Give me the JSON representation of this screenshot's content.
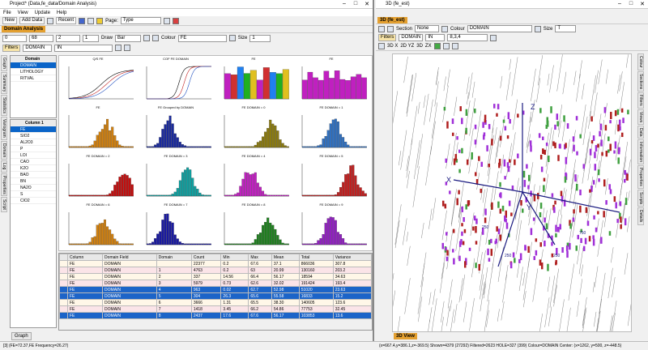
{
  "left_window": {
    "title": "Project* (Data,fe_data/Domain Analysis)",
    "menu": [
      "File",
      "View",
      "Update",
      "Help"
    ],
    "toolbar": {
      "new": "New",
      "add_data": "Add Data",
      "recent": "Recent",
      "page_label": "Page:",
      "page_value": "Type"
    },
    "panel_title": "Domain Analysis",
    "analysis_bar": {
      "v1": "0",
      "v2": "68",
      "v3": "2",
      "v4": "1",
      "draw_label": "Draw",
      "draw_value": "Bar",
      "colour_label": "Colour",
      "colour_value": "FE",
      "size_label": "Size",
      "size_value": "1"
    },
    "filter_bar": {
      "filters": "Filters",
      "field": "DOMAIN",
      "op": "IN"
    },
    "domain_list": {
      "header": "Domain",
      "items": [
        "DOMAIN",
        "LITHOLOGY",
        "RITVAL"
      ]
    },
    "column_list": {
      "header": "Column 1",
      "items": [
        "FE",
        "SIO2",
        "AL2O3",
        "P",
        "LOI",
        "CAO",
        "K2O",
        "BAO",
        "BN",
        "NA2O",
        "S",
        "CIO2"
      ]
    },
    "bottom_tab": "Graph",
    "grid": {
      "columns": [
        "Column",
        "Domain Field",
        "Domain",
        "Count",
        "Min",
        "Max",
        "Mean",
        "Total",
        "Variance"
      ],
      "rows": [
        [
          "FE",
          "DOMAIN",
          "",
          "22377",
          "0.2",
          "67.6",
          "37.1",
          "866036",
          "307.8"
        ],
        [
          "FE",
          "DOMAIN",
          "1",
          "4763",
          "0.2",
          "63",
          "20.99",
          "130160",
          "203.2"
        ],
        [
          "FE",
          "DOMAIN",
          "2",
          "337",
          "14.56",
          "66.4",
          "56.17",
          "18594",
          "34.63"
        ],
        [
          "FE",
          "DOMAIN",
          "3",
          "5979",
          "0.73",
          "62.6",
          "32.02",
          "191424",
          "193.4"
        ],
        [
          "FE",
          "DOMAIN",
          "4",
          "963",
          "0.02",
          "62.7",
          "52.98",
          "51020",
          "23.63"
        ],
        [
          "FE",
          "DOMAIN",
          "5",
          "304",
          "26.3",
          "65.6",
          "55.58",
          "16833",
          "15.2"
        ],
        [
          "FE",
          "DOMAIN",
          "6",
          "3666",
          "1.31",
          "65.5",
          "38.30",
          "140605",
          "123.6"
        ],
        [
          "FE",
          "DOMAIN",
          "7",
          "1418",
          "3.45",
          "66.2",
          "54.86",
          "77753",
          "32.45"
        ],
        [
          "FE",
          "DOMAIN",
          "8",
          "2437",
          "17.6",
          "67.6",
          "56.17",
          "103853",
          "13.6"
        ]
      ]
    },
    "charts": [
      {
        "title": "Q/S FE"
      },
      {
        "title": "COF FE DOMAIN"
      },
      {
        "title": "FE"
      },
      {
        "title": "FE"
      },
      {
        "title": "FE"
      },
      {
        "title": "FE Grouped by DOMAIN"
      },
      {
        "title": "FE DOMAIN = 0"
      },
      {
        "title": "FE DOMAIN = 1"
      },
      {
        "title": "FE DOMAIN = 2"
      },
      {
        "title": "FE DOMAIN = 3"
      },
      {
        "title": "FE DOMAIN = 4"
      },
      {
        "title": "FE DOMAIN = 5"
      },
      {
        "title": "FE DOMAIN = 6"
      },
      {
        "title": "FE DOMAIN = 7"
      },
      {
        "title": "FE DOMAIN = 8"
      },
      {
        "title": "FE DOMAIN = 9"
      }
    ]
  },
  "right_window": {
    "title": "3D (fe_est)",
    "panel_tab": "3D (fe_est)",
    "toolbar": {
      "section_label": "Section",
      "section_value": "None",
      "colour_label": "Colour",
      "colour_value": "DOMAIN",
      "size_label": "Size",
      "size_value": "T"
    },
    "filter_bar": {
      "filters": "Filters",
      "field": "DOMAIN",
      "op": "IN",
      "values": "8,3,4"
    },
    "view_tabs": [
      "3D X",
      "2D YZ",
      "3D",
      "ZX"
    ],
    "axis_labels": {
      "z": "Z",
      "x": "X",
      "y": "Y"
    },
    "tick_labels": [
      "250",
      "750",
      "250",
      "250"
    ],
    "bottom_tab": "3D View",
    "side_tabs": [
      "Colour",
      "Sections",
      "Filters",
      "Views",
      "Data",
      "Information",
      "Properties",
      "Scripts",
      "Details"
    ]
  },
  "left_side_tabs": [
    "Graph",
    "Summary",
    "Statistics",
    "Variogram",
    "Domain",
    "Log",
    "Properties",
    "Script"
  ],
  "status_left": "[3]   (FE=72.37,FE Frequency=26.27)",
  "status_right": "(x=667.4,y=386.1,z=-369.5)   Shown=4379 (27292)   Filtered=2623 HOLE=327 (399) Colour=DOMAIN   Center: (x=1262, y=500, z=-448.5)",
  "colors": {
    "selection": "#0a64c8",
    "accent": "#e4a030",
    "view_bg": "#ffffff"
  }
}
